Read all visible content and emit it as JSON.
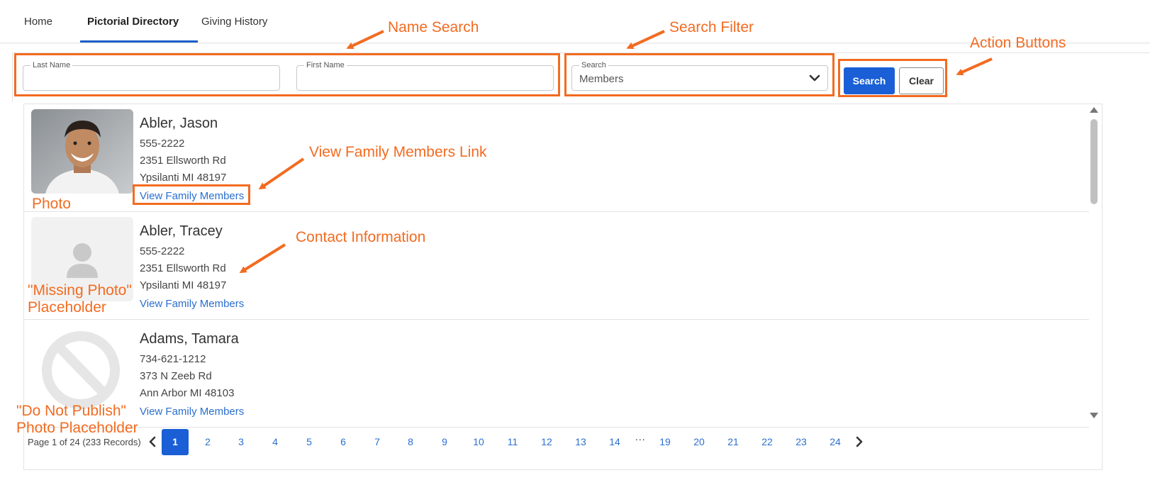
{
  "nav": {
    "tabs": [
      {
        "label": "Home"
      },
      {
        "label": "Pictorial Directory",
        "active": true
      },
      {
        "label": "Giving History"
      }
    ]
  },
  "search": {
    "last_name_label": "Last Name",
    "last_name_value": "",
    "first_name_label": "First Name",
    "first_name_value": "",
    "filter_label": "Search",
    "filter_value": "Members",
    "search_button": "Search",
    "clear_button": "Clear"
  },
  "records": [
    {
      "name": "Abler, Jason",
      "phone": "555-2222",
      "address1": "2351 Ellsworth Rd",
      "address2": "Ypsilanti MI 48197",
      "link": "View Family Members",
      "photo_type": "photo"
    },
    {
      "name": "Abler, Tracey",
      "phone": "555-2222",
      "address1": "2351 Ellsworth Rd",
      "address2": "Ypsilanti MI 48197",
      "link": "View Family Members",
      "photo_type": "missing-photo-placeholder"
    },
    {
      "name": "Adams, Tamara",
      "phone": "734-621-1212",
      "address1": "373 N Zeeb Rd",
      "address2": "Ann Arbor MI 48103",
      "link": "View Family Members",
      "photo_type": "do-not-publish-placeholder"
    }
  ],
  "pagination": {
    "info": "Page 1 of 24 (233 Records)",
    "current": "1",
    "pages_before": [
      "1",
      "2",
      "3",
      "4",
      "5",
      "6",
      "7",
      "8",
      "9",
      "10",
      "11",
      "12",
      "13",
      "14"
    ],
    "ellipsis": "...",
    "pages_after": [
      "19",
      "20",
      "21",
      "22",
      "23",
      "24"
    ]
  },
  "annotations": {
    "name_search": "Name Search",
    "search_filter": "Search Filter",
    "action_buttons": "Action Buttons",
    "view_family_link": "View Family Members Link",
    "photo": "Photo",
    "contact_information": "Contact Information",
    "missing_photo_line1": "\"Missing Photo\"",
    "missing_photo_line2": "Placeholder",
    "do_not_publish_line1": "\"Do Not Publish\"",
    "do_not_publish_line2": "Photo Placeholder"
  },
  "colors": {
    "primary": "#1a5fd6",
    "link": "#2b6fcf",
    "annotation": "#f26b21"
  }
}
